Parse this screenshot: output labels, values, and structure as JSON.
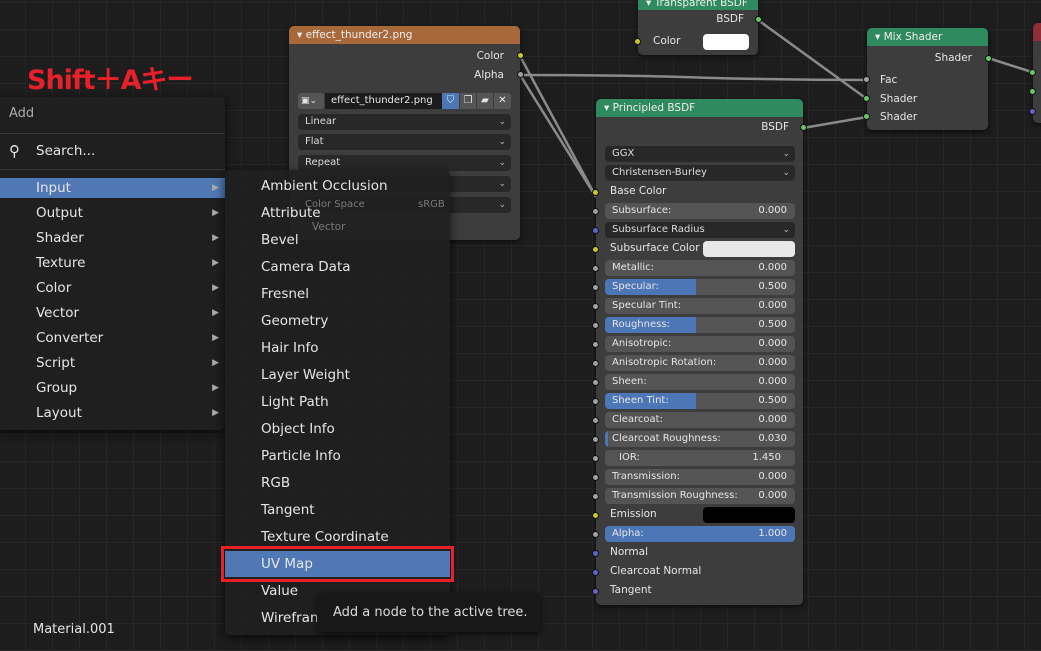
{
  "annotation": {
    "text": "Shift＋Aキー",
    "color": "#e8202a"
  },
  "material_name": "Material.001",
  "colors": {
    "socket_color": "#c7c729",
    "socket_float": "#a1a1a1",
    "socket_vector": "#6363c7",
    "socket_shader": "#63c763",
    "highlight": "#4f78b5",
    "shader_header": "#2f8a5f",
    "texture_header": "#a8693a",
    "output_header": "#8f2e36"
  },
  "image_node": {
    "title": "effect_thunder2.png",
    "outputs": [
      "Color",
      "Alpha"
    ],
    "image_name": "effect_thunder2.png",
    "interpolation": "Linear",
    "projection": "Flat",
    "extension": "Repeat",
    "color_space_label": "Color Space",
    "color_space": "sRGB",
    "vector_label": "Vector"
  },
  "transparent_node": {
    "title": "Transparent BSDF",
    "output": "BSDF",
    "input": "Color",
    "color": "#ffffff"
  },
  "mix_node": {
    "title": "Mix Shader",
    "output": "Shader",
    "inputs": [
      "Fac",
      "Shader",
      "Shader"
    ]
  },
  "principled_node": {
    "title": "Principled BSDF",
    "output": "BSDF",
    "rows": [
      {
        "type": "dropdown",
        "label": "GGX"
      },
      {
        "type": "dropdown",
        "label": "Christensen-Burley"
      },
      {
        "type": "socket",
        "label": "Base Color",
        "socket": "color"
      },
      {
        "type": "slider",
        "label": "Subsurface:",
        "value": "0.000",
        "socket": "float"
      },
      {
        "type": "dropdown",
        "label": "Subsurface Radius",
        "socket": "vector"
      },
      {
        "type": "color",
        "label": "Subsurface Color",
        "swatch": "#e8e8e8",
        "socket": "color"
      },
      {
        "type": "slider",
        "label": "Metallic:",
        "value": "0.000",
        "socket": "float"
      },
      {
        "type": "slider",
        "label": "Specular:",
        "value": "0.500",
        "socket": "float"
      },
      {
        "type": "slider",
        "label": "Specular Tint:",
        "value": "0.000",
        "socket": "float"
      },
      {
        "type": "slider",
        "label": "Roughness:",
        "value": "0.500",
        "socket": "float"
      },
      {
        "type": "slider",
        "label": "Anisotropic:",
        "value": "0.000",
        "socket": "float"
      },
      {
        "type": "slider",
        "label": "Anisotropic Rotation:",
        "value": "0.000",
        "socket": "float"
      },
      {
        "type": "slider",
        "label": "Sheen:",
        "value": "0.000",
        "socket": "float"
      },
      {
        "type": "slider",
        "label": "Sheen Tint:",
        "value": "0.500",
        "socket": "float"
      },
      {
        "type": "slider",
        "label": "Clearcoat:",
        "value": "0.000",
        "socket": "float"
      },
      {
        "type": "slider",
        "label": "Clearcoat Roughness:",
        "value": "0.030",
        "socket": "float"
      },
      {
        "type": "slider",
        "label": "IOR:",
        "value": "1.450",
        "socket": "float",
        "nofill": true
      },
      {
        "type": "slider",
        "label": "Transmission:",
        "value": "0.000",
        "socket": "float"
      },
      {
        "type": "slider",
        "label": "Transmission Roughness:",
        "value": "0.000",
        "socket": "float"
      },
      {
        "type": "color",
        "label": "Emission",
        "swatch": "#000000",
        "socket": "color"
      },
      {
        "type": "slider",
        "label": "Alpha:",
        "value": "1.000",
        "socket": "float"
      },
      {
        "type": "socket",
        "label": "Normal",
        "socket": "vector"
      },
      {
        "type": "socket",
        "label": "Clearcoat Normal",
        "socket": "vector"
      },
      {
        "type": "socket",
        "label": "Tangent",
        "socket": "vector"
      }
    ]
  },
  "add_menu": {
    "title": "Add",
    "search": "Search...",
    "items": [
      {
        "label": "Input",
        "highlighted": true
      },
      {
        "label": "Output"
      },
      {
        "label": "Shader"
      },
      {
        "label": "Texture"
      },
      {
        "label": "Color"
      },
      {
        "label": "Vector"
      },
      {
        "label": "Converter"
      },
      {
        "label": "Script"
      },
      {
        "label": "Group"
      },
      {
        "label": "Layout"
      }
    ]
  },
  "input_submenu": {
    "items": [
      {
        "label": "Ambient Occlusion"
      },
      {
        "label": "Attribute"
      },
      {
        "label": "Bevel"
      },
      {
        "label": "Camera Data"
      },
      {
        "label": "Fresnel"
      },
      {
        "label": "Geometry"
      },
      {
        "label": "Hair Info"
      },
      {
        "label": "Layer Weight"
      },
      {
        "label": "Light Path"
      },
      {
        "label": "Object Info"
      },
      {
        "label": "Particle Info"
      },
      {
        "label": "RGB"
      },
      {
        "label": "Tangent"
      },
      {
        "label": "Texture Coordinate"
      },
      {
        "label": "UV Map",
        "highlighted": true
      },
      {
        "label": "Value"
      },
      {
        "label": "Wireframe"
      }
    ]
  },
  "tooltip": "Add a node to the active tree."
}
